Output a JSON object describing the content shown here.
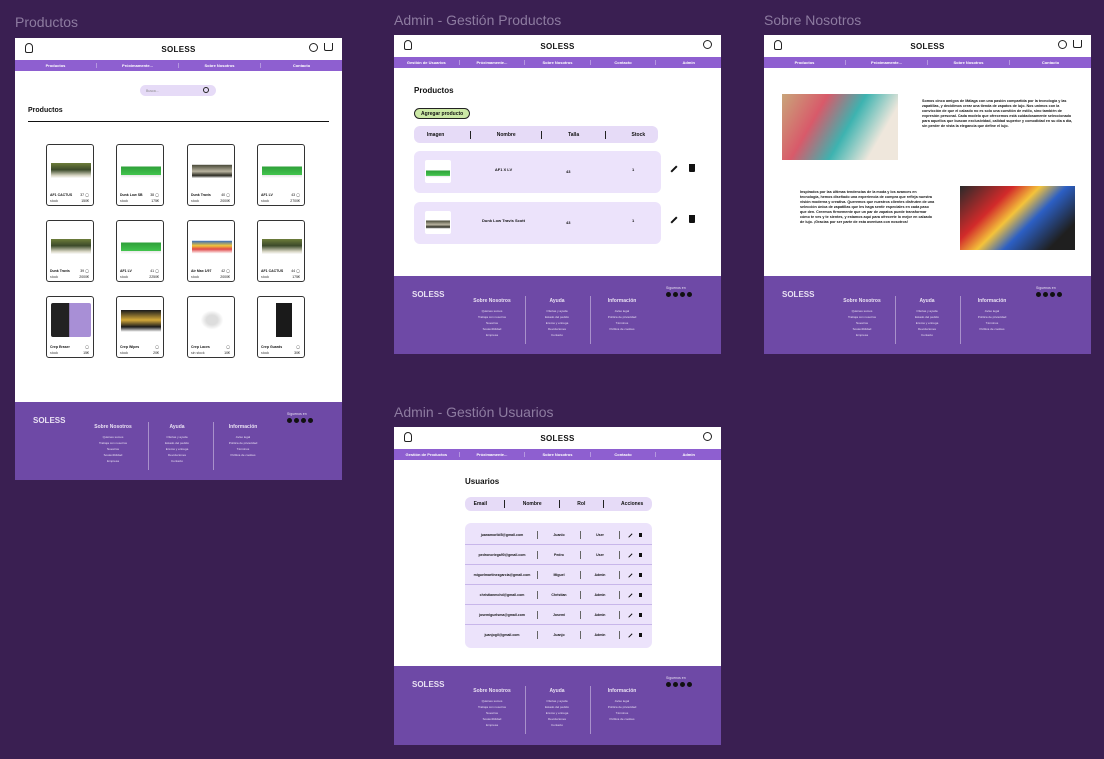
{
  "frames": {
    "productos": {
      "label": "Productos"
    },
    "admin_productos": {
      "label": "Admin - Gestión Productos"
    },
    "sobre": {
      "label": "Sobre Nosotros"
    },
    "admin_usuarios": {
      "label": "Admin - Gestión Usuarios"
    }
  },
  "brand": "SOLESS",
  "nav_public": [
    "Productos",
    "Próximamente...",
    "Sobre Nosotros",
    "Contacto"
  ],
  "nav_admin_prod": [
    "Gestión de Usuarios",
    "Próximamente...",
    "Sobre Nosotros",
    "Contacto",
    "Admin"
  ],
  "nav_admin_users": [
    "Gestión de Productos",
    "Próximamente...",
    "Sobre Nosotros",
    "Contacto",
    "Admin"
  ],
  "search": {
    "placeholder": "Busca..."
  },
  "productos_title": "Productos",
  "products": [
    {
      "name": "AF1 CACTUS",
      "size": "37",
      "stock": "stock",
      "price": "150€",
      "img": "shoe-camo"
    },
    {
      "name": "Dunk Low SB",
      "size": "38",
      "stock": "stock",
      "price": "175€",
      "img": "shoe-green"
    },
    {
      "name": "Dunk Travis",
      "size": "40",
      "stock": "stock",
      "price": "2000€",
      "img": "shoe-dark"
    },
    {
      "name": "AF1 LV",
      "size": "43",
      "stock": "stock",
      "price": "2700€",
      "img": "shoe-green"
    },
    {
      "name": "Dunk Travis",
      "size": "39",
      "stock": "stock",
      "price": "2000€",
      "img": "shoe-camo"
    },
    {
      "name": "AF1 LV",
      "size": "41",
      "stock": "stock",
      "price": "2250€",
      "img": "shoe-green"
    },
    {
      "name": "Air Max 1/97",
      "size": "42",
      "stock": "stock",
      "price": "2000€",
      "img": "shoe-max"
    },
    {
      "name": "AF1 CACTUS",
      "size": "44",
      "stock": "stock",
      "price": "175€",
      "img": "shoe-camo"
    },
    {
      "name": "Crep Eraser",
      "size": "",
      "stock": "stock",
      "price": "15€",
      "img": "box-purple"
    },
    {
      "name": "Crep Wipes",
      "size": "",
      "stock": "stock",
      "price": "20€",
      "img": "box-black"
    },
    {
      "name": "Crep Laces",
      "size": "",
      "stock": "sin stock",
      "price": "10€",
      "img": "laces"
    },
    {
      "name": "Crep Guards",
      "size": "",
      "stock": "stock",
      "price": "30€",
      "img": "bag-black"
    }
  ],
  "footer": {
    "brand": "SOLESS",
    "col1": {
      "title": "Sobre Nosotros",
      "items": [
        "Quiénes somos",
        "Trabaja con nosotros",
        "Nuestros",
        "Sostenibilidad",
        "Empresa"
      ]
    },
    "col2": {
      "title": "Ayuda",
      "items": [
        "Ofertas y ayuda",
        "Estado del pedido",
        "Envíos y entrega",
        "Devoluciones",
        "Contacto"
      ]
    },
    "col3": {
      "title": "Información",
      "items": [
        "Aviso legal",
        "Política de privacidad",
        "Términos",
        "Política de cookies"
      ]
    },
    "follow": "Síguenos en"
  },
  "admin_productos": {
    "title": "Productos",
    "add_button": "Agregar producto",
    "columns": [
      "Imagen",
      "Nombre",
      "Talla",
      "Stock"
    ],
    "rows": [
      {
        "name": "AF1 X LV",
        "size": "43",
        "stock": "1",
        "img": "shoe-green"
      },
      {
        "name": "Dunk Low Travis Scott",
        "size": "43",
        "stock": "1",
        "img": "shoe-dark"
      }
    ]
  },
  "sobre": {
    "p1": "Somos cinco amigos de Málaga con una pasión compartida por la tecnología y las zapatillas, y decidimos crear una tienda de zapatos de lujo. Nos unimos con la convicción de que el calzado no es solo una cuestión de estilo, sino también de expresión personal. Cada modelo que ofrecemos está cuidadosamente seleccionado para aquellos que buscan exclusividad, calidad superior y comodidad en su día a día, sin perder de vista la elegancia que define el lujo.",
    "p2": "Inspirados por las últimas tendencias de la moda y los avances en tecnología, hemos diseñado una experiencia de compra que refleja nuestra visión moderna y creativa. Queremos que nuestros clientes disfruten de una selección única de zapatillas que les haga sentir especiales en cada paso que den. Creemos firmemente que un par de zapatos puede transformar cómo te ves y te sientes, y estamos aquí para ofrecerte lo mejor en calzado de lujo. ¡Gracias por ser parte de esta aventura con nosotros!"
  },
  "admin_usuarios": {
    "title": "Usuarios",
    "columns": [
      "Email",
      "Nombre",
      "Rol",
      "Acciones"
    ],
    "rows": [
      {
        "email": "juanamorlid5@gmail.com",
        "name": "Juanlo",
        "role": "User"
      },
      {
        "email": "pedronoriega90@gmail.com",
        "name": "Pedro",
        "role": "User"
      },
      {
        "email": "miguelmartinezgarcia@gmail.com",
        "name": "Miguel",
        "role": "Admin"
      },
      {
        "email": "christianmchd@gmail.com",
        "name": "Christian",
        "role": "Admin"
      },
      {
        "email": "josemiguelsma@gmail.com",
        "name": "Josemi",
        "role": "Admin"
      },
      {
        "email": "juanjogil@gmail.com",
        "name": "Juanjo",
        "role": "Admin"
      }
    ]
  },
  "colors": {
    "bg": "#3a1f52",
    "nav": "#8e5fd0",
    "footer": "#6e49a6",
    "row": "#ece3fb"
  }
}
